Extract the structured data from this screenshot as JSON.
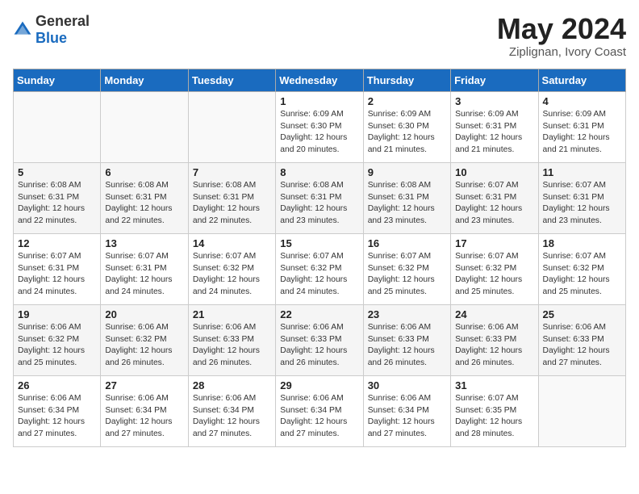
{
  "logo": {
    "general": "General",
    "blue": "Blue"
  },
  "header": {
    "month_year": "May 2024",
    "location": "Ziplignan, Ivory Coast"
  },
  "weekdays": [
    "Sunday",
    "Monday",
    "Tuesday",
    "Wednesday",
    "Thursday",
    "Friday",
    "Saturday"
  ],
  "weeks": [
    [
      {
        "day": "",
        "info": ""
      },
      {
        "day": "",
        "info": ""
      },
      {
        "day": "",
        "info": ""
      },
      {
        "day": "1",
        "info": "Sunrise: 6:09 AM\nSunset: 6:30 PM\nDaylight: 12 hours\nand 20 minutes."
      },
      {
        "day": "2",
        "info": "Sunrise: 6:09 AM\nSunset: 6:30 PM\nDaylight: 12 hours\nand 21 minutes."
      },
      {
        "day": "3",
        "info": "Sunrise: 6:09 AM\nSunset: 6:31 PM\nDaylight: 12 hours\nand 21 minutes."
      },
      {
        "day": "4",
        "info": "Sunrise: 6:09 AM\nSunset: 6:31 PM\nDaylight: 12 hours\nand 21 minutes."
      }
    ],
    [
      {
        "day": "5",
        "info": "Sunrise: 6:08 AM\nSunset: 6:31 PM\nDaylight: 12 hours\nand 22 minutes."
      },
      {
        "day": "6",
        "info": "Sunrise: 6:08 AM\nSunset: 6:31 PM\nDaylight: 12 hours\nand 22 minutes."
      },
      {
        "day": "7",
        "info": "Sunrise: 6:08 AM\nSunset: 6:31 PM\nDaylight: 12 hours\nand 22 minutes."
      },
      {
        "day": "8",
        "info": "Sunrise: 6:08 AM\nSunset: 6:31 PM\nDaylight: 12 hours\nand 23 minutes."
      },
      {
        "day": "9",
        "info": "Sunrise: 6:08 AM\nSunset: 6:31 PM\nDaylight: 12 hours\nand 23 minutes."
      },
      {
        "day": "10",
        "info": "Sunrise: 6:07 AM\nSunset: 6:31 PM\nDaylight: 12 hours\nand 23 minutes."
      },
      {
        "day": "11",
        "info": "Sunrise: 6:07 AM\nSunset: 6:31 PM\nDaylight: 12 hours\nand 23 minutes."
      }
    ],
    [
      {
        "day": "12",
        "info": "Sunrise: 6:07 AM\nSunset: 6:31 PM\nDaylight: 12 hours\nand 24 minutes."
      },
      {
        "day": "13",
        "info": "Sunrise: 6:07 AM\nSunset: 6:31 PM\nDaylight: 12 hours\nand 24 minutes."
      },
      {
        "day": "14",
        "info": "Sunrise: 6:07 AM\nSunset: 6:32 PM\nDaylight: 12 hours\nand 24 minutes."
      },
      {
        "day": "15",
        "info": "Sunrise: 6:07 AM\nSunset: 6:32 PM\nDaylight: 12 hours\nand 24 minutes."
      },
      {
        "day": "16",
        "info": "Sunrise: 6:07 AM\nSunset: 6:32 PM\nDaylight: 12 hours\nand 25 minutes."
      },
      {
        "day": "17",
        "info": "Sunrise: 6:07 AM\nSunset: 6:32 PM\nDaylight: 12 hours\nand 25 minutes."
      },
      {
        "day": "18",
        "info": "Sunrise: 6:07 AM\nSunset: 6:32 PM\nDaylight: 12 hours\nand 25 minutes."
      }
    ],
    [
      {
        "day": "19",
        "info": "Sunrise: 6:06 AM\nSunset: 6:32 PM\nDaylight: 12 hours\nand 25 minutes."
      },
      {
        "day": "20",
        "info": "Sunrise: 6:06 AM\nSunset: 6:32 PM\nDaylight: 12 hours\nand 26 minutes."
      },
      {
        "day": "21",
        "info": "Sunrise: 6:06 AM\nSunset: 6:33 PM\nDaylight: 12 hours\nand 26 minutes."
      },
      {
        "day": "22",
        "info": "Sunrise: 6:06 AM\nSunset: 6:33 PM\nDaylight: 12 hours\nand 26 minutes."
      },
      {
        "day": "23",
        "info": "Sunrise: 6:06 AM\nSunset: 6:33 PM\nDaylight: 12 hours\nand 26 minutes."
      },
      {
        "day": "24",
        "info": "Sunrise: 6:06 AM\nSunset: 6:33 PM\nDaylight: 12 hours\nand 26 minutes."
      },
      {
        "day": "25",
        "info": "Sunrise: 6:06 AM\nSunset: 6:33 PM\nDaylight: 12 hours\nand 27 minutes."
      }
    ],
    [
      {
        "day": "26",
        "info": "Sunrise: 6:06 AM\nSunset: 6:34 PM\nDaylight: 12 hours\nand 27 minutes."
      },
      {
        "day": "27",
        "info": "Sunrise: 6:06 AM\nSunset: 6:34 PM\nDaylight: 12 hours\nand 27 minutes."
      },
      {
        "day": "28",
        "info": "Sunrise: 6:06 AM\nSunset: 6:34 PM\nDaylight: 12 hours\nand 27 minutes."
      },
      {
        "day": "29",
        "info": "Sunrise: 6:06 AM\nSunset: 6:34 PM\nDaylight: 12 hours\nand 27 minutes."
      },
      {
        "day": "30",
        "info": "Sunrise: 6:06 AM\nSunset: 6:34 PM\nDaylight: 12 hours\nand 27 minutes."
      },
      {
        "day": "31",
        "info": "Sunrise: 6:07 AM\nSunset: 6:35 PM\nDaylight: 12 hours\nand 28 minutes."
      },
      {
        "day": "",
        "info": ""
      }
    ]
  ]
}
